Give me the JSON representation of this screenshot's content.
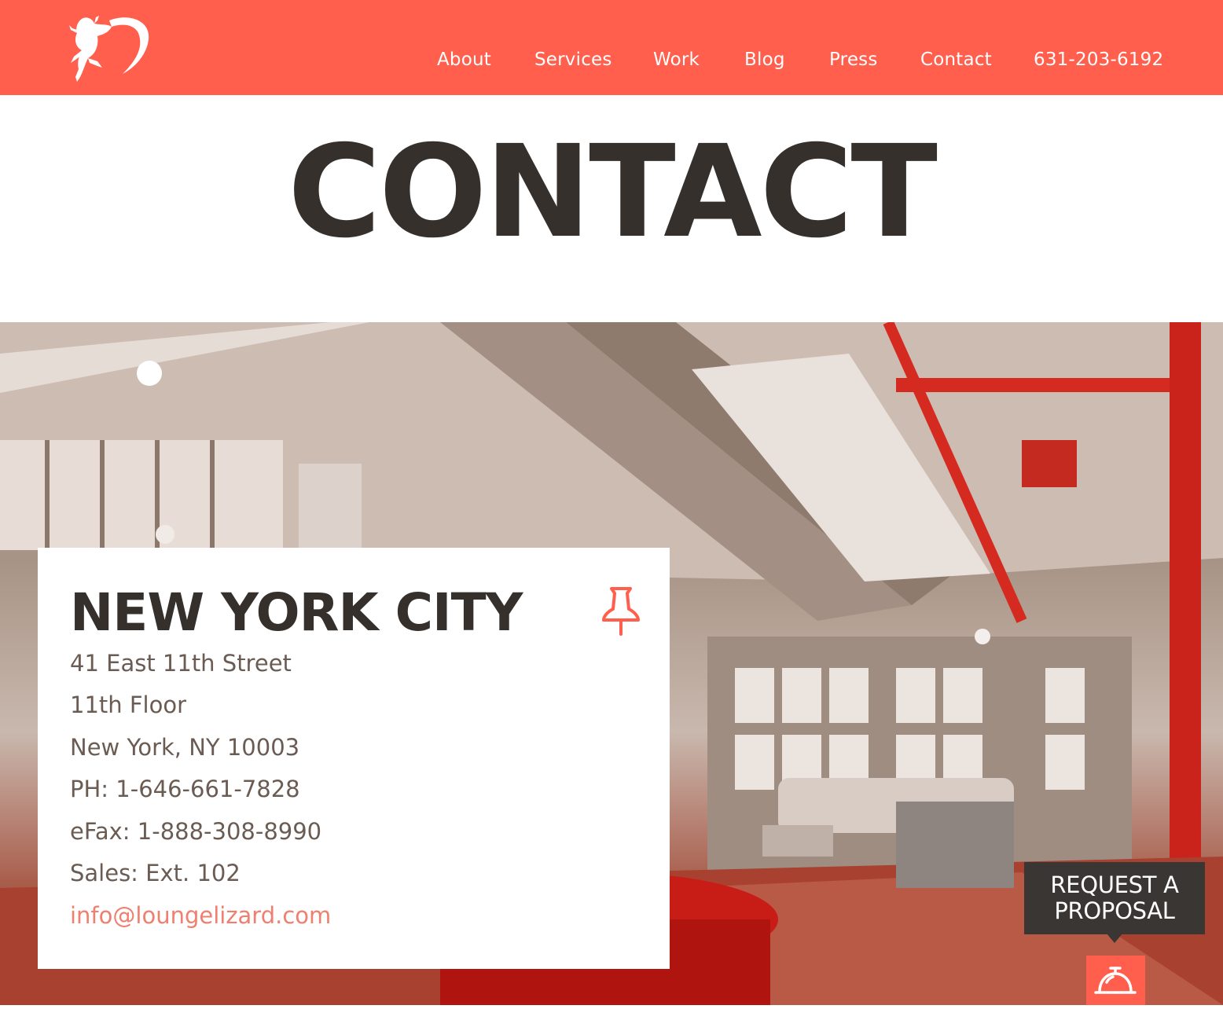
{
  "header": {
    "logo": "lounge-lizard-logo",
    "nav": [
      {
        "label": "About"
      },
      {
        "label": "Services"
      },
      {
        "label": "Work"
      },
      {
        "label": "Blog"
      },
      {
        "label": "Press"
      },
      {
        "label": "Contact"
      },
      {
        "label": "631-203-6192"
      }
    ]
  },
  "page": {
    "title": "CONTACT"
  },
  "location": {
    "city": "NEW YORK CITY",
    "icon": "pushpin-icon",
    "lines": [
      "41 East 11th Street",
      "11th Floor",
      "New York, NY 10003",
      "PH: 1-646-661-7828",
      "eFax: 1-888-308-8990",
      "Sales: Ext. 102"
    ],
    "email": "info@loungelizard.com"
  },
  "proposal": {
    "line1": "REQUEST A",
    "line2": "PROPOSAL",
    "icon": "service-bell-icon"
  },
  "colors": {
    "brand": "#ff5f4c",
    "dark": "#35302c",
    "text": "#6b5c53",
    "link": "#ef7f6e"
  }
}
